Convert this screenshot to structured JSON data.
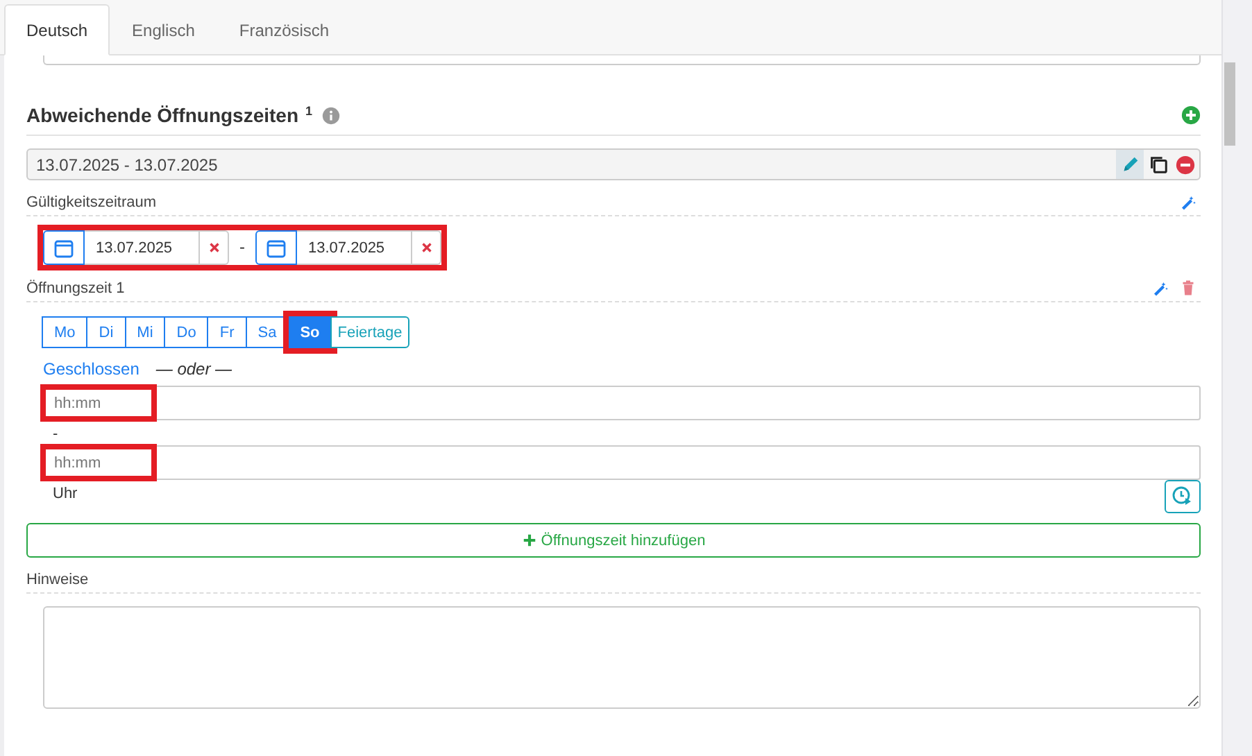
{
  "tabs": [
    {
      "label": "Deutsch",
      "selected": true
    },
    {
      "label": "Englisch",
      "selected": false
    },
    {
      "label": "Französisch",
      "selected": false
    }
  ],
  "section": {
    "title": "Abweichende Öffnungszeiten",
    "count": "1"
  },
  "entries": [
    {
      "summary": "13.07.2025 - 13.07.2025",
      "editing": true
    }
  ],
  "validity": {
    "label": "Gültigkeitszeitraum",
    "highlighted": true,
    "from": "13.07.2025",
    "separator": "-",
    "to": "13.07.2025"
  },
  "opening_times": [
    {
      "label": "Öffnungszeit 1",
      "days": [
        {
          "label": "Mo",
          "kind": "day",
          "selected": false,
          "highlighted": false
        },
        {
          "label": "Di",
          "kind": "day",
          "selected": false,
          "highlighted": false
        },
        {
          "label": "Mi",
          "kind": "day",
          "selected": false,
          "highlighted": false
        },
        {
          "label": "Do",
          "kind": "day",
          "selected": false,
          "highlighted": false
        },
        {
          "label": "Fr",
          "kind": "day",
          "selected": false,
          "highlighted": false
        },
        {
          "label": "Sa",
          "kind": "day",
          "selected": false,
          "highlighted": false
        },
        {
          "label": "So",
          "kind": "day",
          "selected": true,
          "highlighted": true
        },
        {
          "label": "Feiertage",
          "kind": "holiday",
          "selected": false,
          "highlighted": false
        }
      ],
      "closed_link": "Geschlossen",
      "or_text": "— oder —",
      "from": {
        "placeholder": "hh:mm",
        "highlighted": true
      },
      "separator": "-",
      "to": {
        "placeholder": "hh:mm",
        "highlighted": true
      },
      "unit": "Uhr"
    }
  ],
  "add_button": "Öffnungszeit hinzufügen",
  "notes": {
    "label": "Hinweise"
  }
}
